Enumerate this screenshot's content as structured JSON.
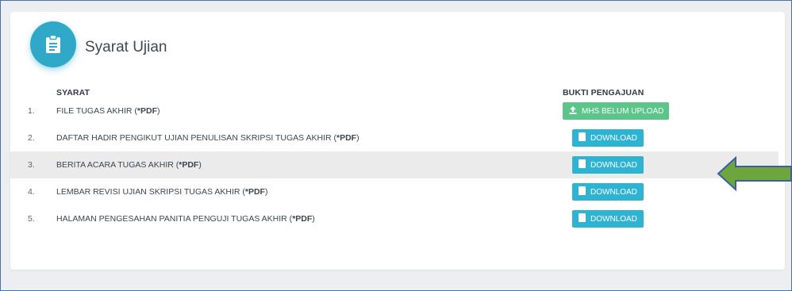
{
  "header": {
    "title": "Syarat Ujian",
    "icon": "clipboard-icon"
  },
  "columns": {
    "syarat": "SYARAT",
    "bukti": "BUKTI PENGAJUAN"
  },
  "rows": [
    {
      "num": "1.",
      "label": "FILE TUGAS AKHIR (",
      "label_bold": "*PDF",
      "label_end": ")",
      "button": "MHS BELUM UPLOAD",
      "button_icon": "upload-icon"
    },
    {
      "num": "2.",
      "label": "DAFTAR HADIR PENGIKUT UJIAN PENULISAN SKRIPSI TUGAS AKHIR (",
      "label_bold": "*PDF",
      "label_end": ")",
      "button": "DOWNLOAD",
      "button_icon": "file-icon"
    },
    {
      "num": "3.",
      "label": "BERITA ACARA TUGAS AKHIR (",
      "label_bold": "*PDF",
      "label_end": ")",
      "button": "DOWNLOAD",
      "button_icon": "file-icon"
    },
    {
      "num": "4.",
      "label": "LEMBAR REVISI UJIAN SKRIPSI TUGAS AKHIR (",
      "label_bold": "*PDF",
      "label_end": ")",
      "button": "DOWNLOAD",
      "button_icon": "file-icon"
    },
    {
      "num": "5.",
      "label": "HALAMAN PENGESAHAN PANITIA PENGUJI TUGAS AKHIR (",
      "label_bold": "*PDF",
      "label_end": ")",
      "button": "DOWNLOAD",
      "button_icon": "file-icon"
    }
  ],
  "highlighted_row": 3,
  "colors": {
    "accent": "#2eb3d3",
    "success": "#5bc58a",
    "arrow": "#6fa63c",
    "arrow_outline": "#3a5ea8"
  }
}
